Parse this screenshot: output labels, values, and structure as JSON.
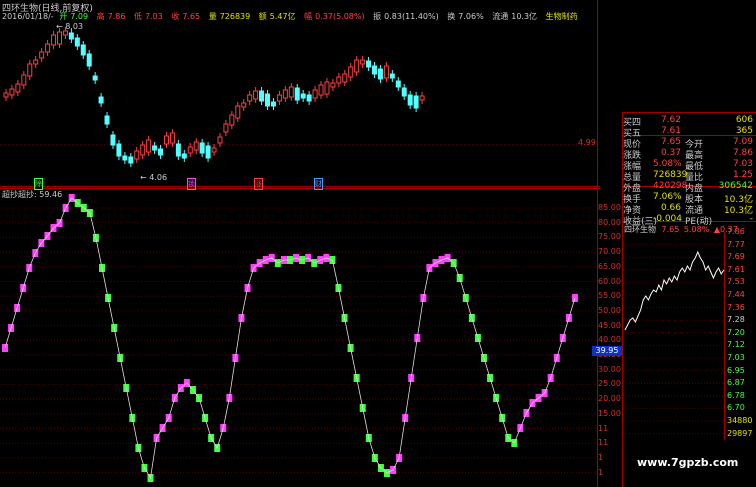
{
  "header": {
    "stock_title": "四环生物(日线,前复权)",
    "date": "2016/01/18/-",
    "open_label": "开",
    "open": "7.09",
    "high_label": "高",
    "high": "7.86",
    "low_label": "低",
    "low": "7.03",
    "close_label": "收",
    "close": "7.65",
    "volume_label": "量",
    "volume": "726839",
    "amount_label": "额",
    "amount": "5.47亿",
    "amp_label": "幅",
    "amp": "0.37(5.08%)",
    "swing_label": "振",
    "swing": "0.83(11.40%)",
    "turnover_label": "换",
    "turnover": "7.06%",
    "float_label": "流通",
    "float": "10.3亿",
    "sector": "生物制药"
  },
  "price_panel": {
    "high_marker": "8.03",
    "low_marker": "4.06",
    "axis_label": "4.99",
    "badges": [
      "除",
      "锁",
      "涨",
      "财"
    ]
  },
  "indicator": {
    "name": "超抄",
    "value_label": "超抄:",
    "value": "59.46",
    "current_tag": "39.95",
    "axis": [
      "85.00",
      "80.00",
      "75.00",
      "70.00",
      "65.00",
      "60.00",
      "55.00",
      "50.00",
      "45.00",
      "40.00",
      "35.00",
      "30.00",
      "25.00",
      "20.00",
      "15.00",
      "11",
      "11",
      "1",
      "1"
    ]
  },
  "quote": {
    "rows": [
      {
        "l": "买四",
        "v1": "7.62",
        "v2": "606",
        "c1": "#ff4040",
        "c2": "#e0e000"
      },
      {
        "l": "买五",
        "v1": "7.61",
        "v2": "365",
        "c1": "#ff4040",
        "c2": "#e0e000"
      }
    ],
    "stats": [
      {
        "l1": "现价",
        "v1": "7.65",
        "l2": "今开",
        "v2": "7.09",
        "c1": "#ff4040",
        "c2": "#ff4040"
      },
      {
        "l1": "涨跌",
        "v1": "0.37",
        "l2": "最高",
        "v2": "7.86",
        "c1": "#ff4040",
        "c2": "#ff4040"
      },
      {
        "l1": "涨幅",
        "v1": "5.08%",
        "l2": "最低",
        "v2": "7.03",
        "c1": "#ff4040",
        "c2": "#ff4040"
      },
      {
        "l1": "总量",
        "v1": "726839",
        "l2": "量比",
        "v2": "1.25",
        "c1": "#e0e000",
        "c2": "#ff4040"
      },
      {
        "l1": "外盘",
        "v1": "420298",
        "l2": "内盘",
        "v2": "306542",
        "c1": "#ff4040",
        "c2": "#40ff40"
      },
      {
        "l1": "换手",
        "v1": "7.06%",
        "l2": "股本",
        "v2": "10.3亿",
        "c1": "#e0e000",
        "c2": "#e0e000"
      },
      {
        "l1": "净资",
        "v1": "0.66",
        "l2": "流通",
        "v2": "10.3亿",
        "c1": "#e0e000",
        "c2": "#e0e000"
      },
      {
        "l1": "收益(三)",
        "v1": "-0.004",
        "l2": "PE(动)",
        "v2": "-",
        "c1": "#e0e000",
        "c2": "#e0e000"
      }
    ]
  },
  "mini_chart": {
    "title": "四环生物",
    "price": "7.65",
    "pct": "5.08%",
    "change": "▲0.37",
    "y_axis": [
      "7.86",
      "7.77",
      "7.69",
      "7.61",
      "7.53",
      "7.44",
      "7.36",
      "7.28",
      "7.20",
      "7.12",
      "7.03",
      "6.95",
      "6.87",
      "6.78",
      "6.70",
      "34880",
      "29897"
    ]
  },
  "watermark": "www.7gpzb.com"
}
